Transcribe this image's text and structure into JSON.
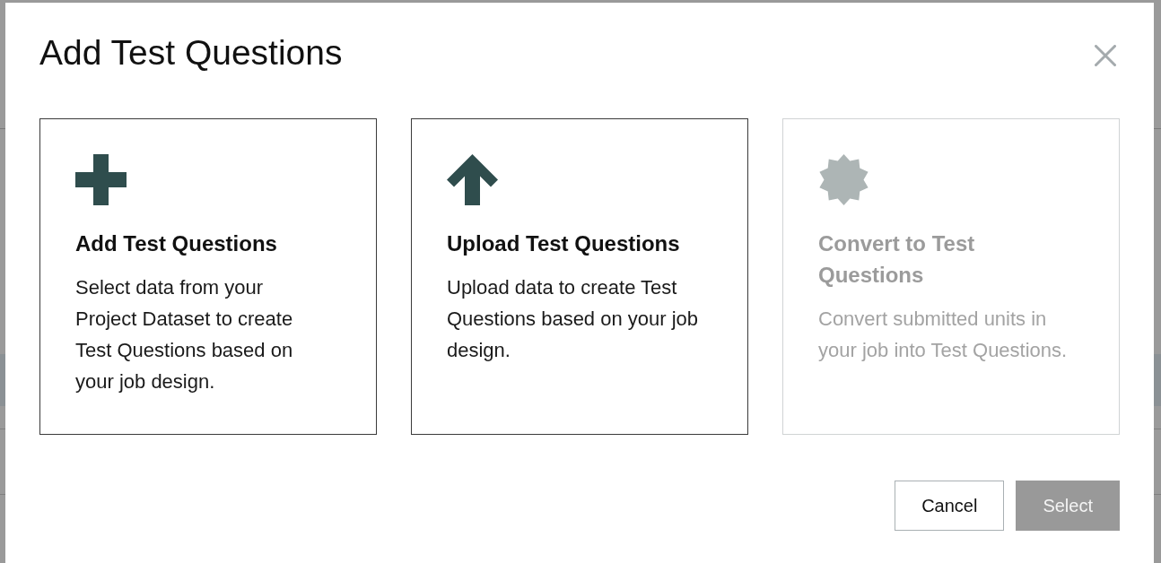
{
  "dialog": {
    "title": "Add Test Questions",
    "options": [
      {
        "kind": "add",
        "title": "Add Test Questions",
        "description": "Select data from your Project Dataset to create Test Questions based on your job design.",
        "selected": false,
        "disabled": false
      },
      {
        "kind": "upload",
        "title": "Upload Test Questions",
        "description": "Upload data to create Test Questions based on your job design.",
        "selected": false,
        "disabled": false
      },
      {
        "kind": "convert",
        "title": "Convert to Test Questions",
        "description": "Convert submitted units in your job into Test Questions.",
        "selected": false,
        "disabled": true
      }
    ],
    "buttons": [
      {
        "kind": "secondary",
        "label": "Cancel",
        "disabled": false
      },
      {
        "kind": "primary",
        "label": "Select",
        "disabled": true
      }
    ]
  }
}
